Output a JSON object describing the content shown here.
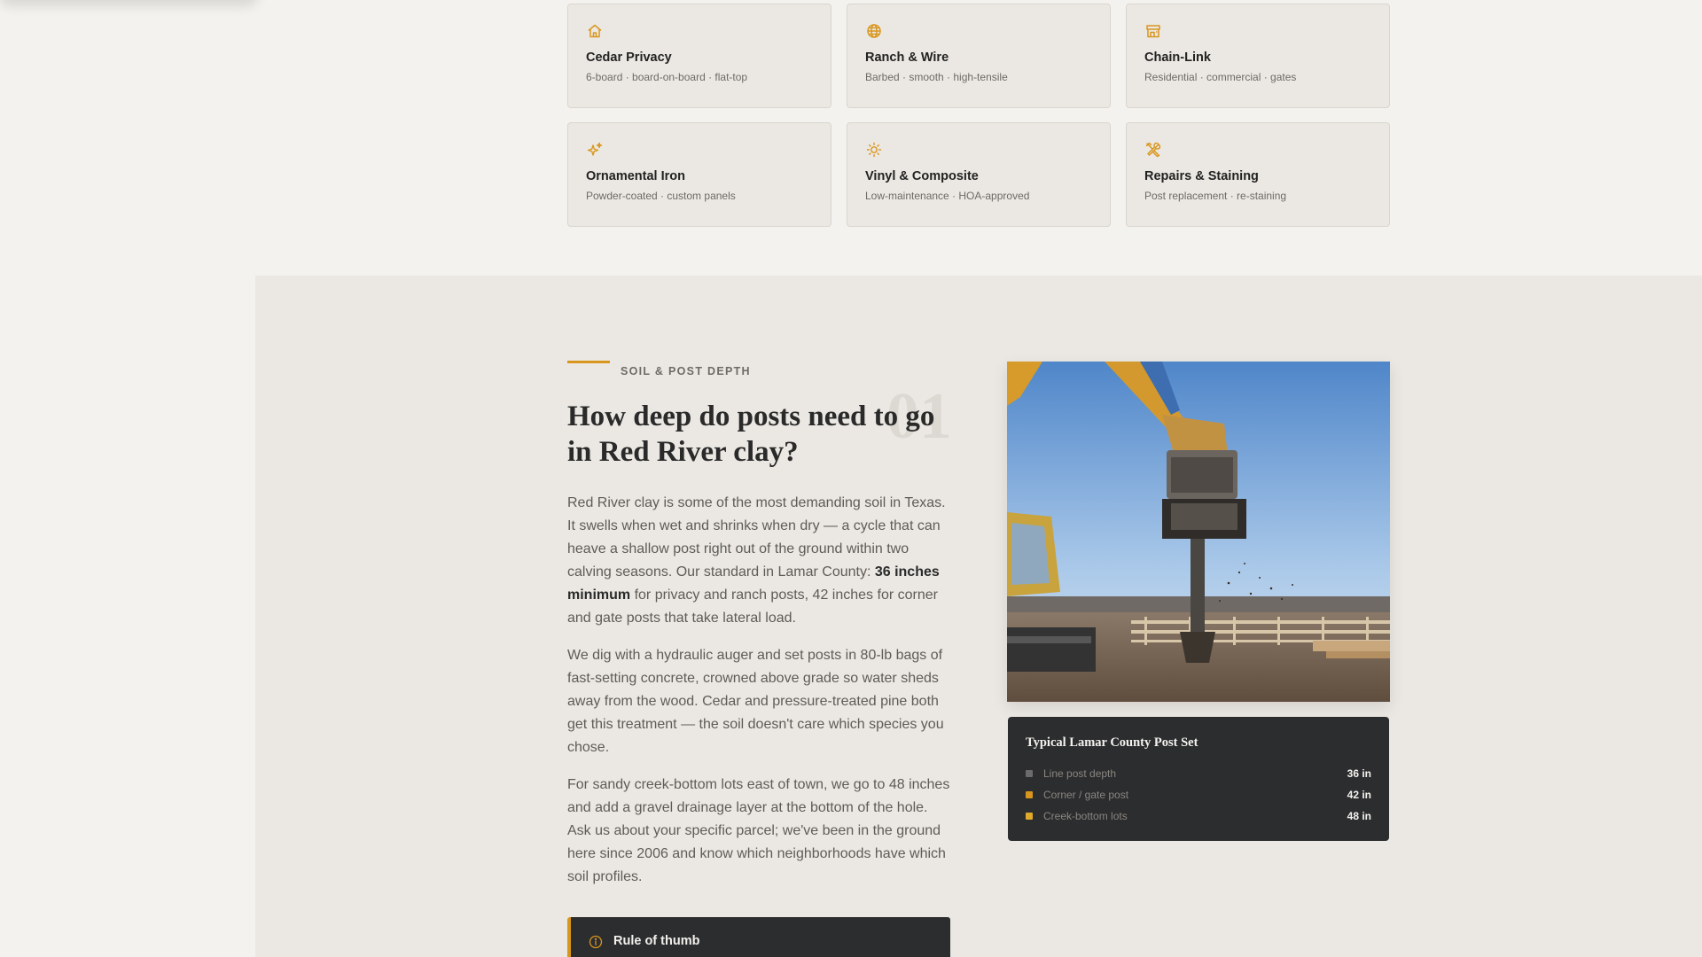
{
  "services": [
    {
      "icon": "home-icon",
      "title": "Cedar Privacy",
      "subtitle": "6-board · board-on-board · flat-top"
    },
    {
      "icon": "globe-icon",
      "title": "Ranch & Wire",
      "subtitle": "Barbed · smooth · high-tensile"
    },
    {
      "icon": "storefront-icon",
      "title": "Chain-Link",
      "subtitle": "Residential · commercial · gates"
    },
    {
      "icon": "sparkles-icon",
      "title": "Ornamental Iron",
      "subtitle": "Powder-coated · custom panels"
    },
    {
      "icon": "sun-icon",
      "title": "Vinyl & Composite",
      "subtitle": "Low-maintenance · HOA-approved"
    },
    {
      "icon": "tools-icon",
      "title": "Repairs & Staining",
      "subtitle": "Post replacement · re-staining"
    }
  ],
  "section": {
    "eyebrow": "SOIL & POST DEPTH",
    "number": "01",
    "heading": "How deep do posts need to go in Red River clay?",
    "p1_before": "Red River clay is some of the most demanding soil in Texas. It swells when wet and shrinks when dry — a cycle that can heave a shallow post right out of the ground within two calving seasons. Our standard in Lamar County: ",
    "p1_bold": "36 inches minimum",
    "p1_after": " for privacy and ranch posts, 42 inches for corner and gate posts that take lateral load.",
    "p2": "We dig with a hydraulic auger and set posts in 80-lb bags of fast-setting concrete, crowned above grade so water sheds away from the wood. Cedar and pressure-treated pine both get this treatment — the soil doesn't care which species you chose.",
    "p3": "For sandy creek-bottom lots east of town, we go to 48 inches and add a gravel drainage layer at the bottom of the hole. Ask us about your specific parcel; we've been in the ground here since 2006 and know which neighborhoods have which soil profiles.",
    "rule_title": "Rule of thumb"
  },
  "spec_card": {
    "title": "Typical Lamar County Post Set",
    "rows": [
      {
        "label": "Line post depth",
        "value": "36 in",
        "color": "#6b6b6b"
      },
      {
        "label": "Corner / gate post",
        "value": "42 in",
        "color": "#d9961e"
      },
      {
        "label": "Creek-bottom lots",
        "value": "48 in",
        "color": "#e0a92a"
      }
    ]
  },
  "colors": {
    "accent": "#d9961e",
    "dark_card": "#2c2d2f",
    "section_bg": "#ebe8e3",
    "page_bg": "#f4f2ee"
  }
}
